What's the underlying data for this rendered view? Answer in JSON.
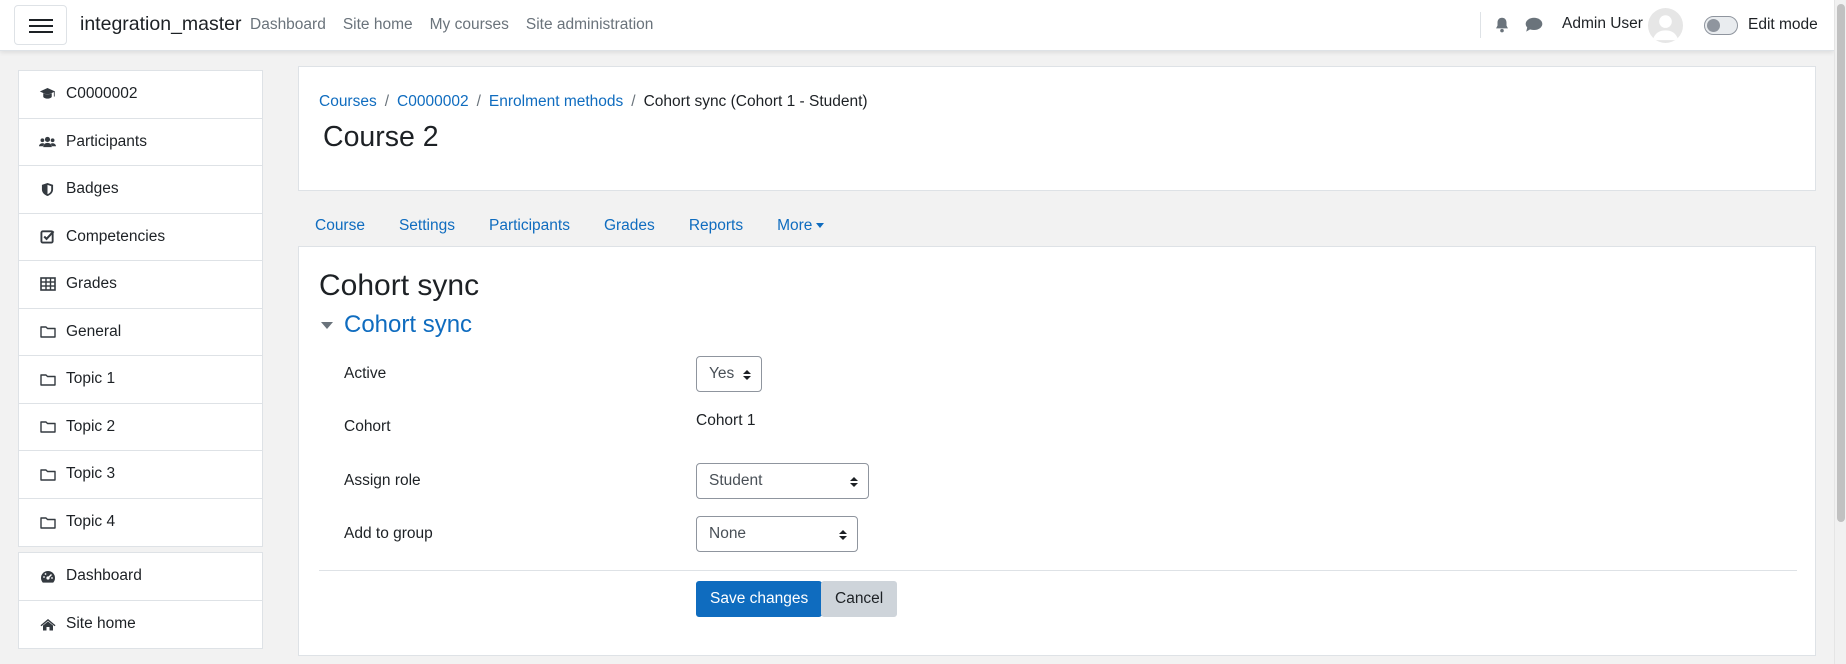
{
  "navbar": {
    "site_name": "integration_master",
    "links": [
      "Dashboard",
      "Site home",
      "My courses",
      "Site administration"
    ],
    "user_name": "Admin User",
    "edit_mode_label": "Edit mode",
    "edit_mode_on": false
  },
  "drawer": {
    "course_items": [
      {
        "label": "C0000002",
        "icon": "graduation-cap-icon"
      },
      {
        "label": "Participants",
        "icon": "users-icon"
      },
      {
        "label": "Badges",
        "icon": "shield-icon"
      },
      {
        "label": "Competencies",
        "icon": "checkbox-icon"
      },
      {
        "label": "Grades",
        "icon": "table-icon"
      },
      {
        "label": "General",
        "icon": "folder-icon"
      },
      {
        "label": "Topic 1",
        "icon": "folder-icon"
      },
      {
        "label": "Topic 2",
        "icon": "folder-icon"
      },
      {
        "label": "Topic 3",
        "icon": "folder-icon"
      },
      {
        "label": "Topic 4",
        "icon": "folder-icon"
      }
    ],
    "site_items": [
      {
        "label": "Dashboard",
        "icon": "dashboard-icon"
      },
      {
        "label": "Site home",
        "icon": "home-icon"
      }
    ]
  },
  "header": {
    "breadcrumb": [
      "Courses",
      "C0000002",
      "Enrolment methods"
    ],
    "breadcrumb_current": "Cohort sync (Cohort 1 - Student)",
    "title": "Course 2"
  },
  "secondary_nav": {
    "items": [
      "Course",
      "Settings",
      "Participants",
      "Grades",
      "Reports"
    ],
    "more_label": "More"
  },
  "form": {
    "heading": "Cohort sync",
    "section_title": "Cohort sync",
    "active_label": "Active",
    "active_value": "Yes",
    "cohort_label": "Cohort",
    "cohort_value": "Cohort 1",
    "role_label": "Assign role",
    "role_value": "Student",
    "group_label": "Add to group",
    "group_value": "None",
    "save_label": "Save changes",
    "cancel_label": "Cancel"
  },
  "colors": {
    "link": "#0f6cbf",
    "primary_button": "#0f6cbf",
    "secondary_button": "#ced4da",
    "page_background": "#f2f2f2"
  }
}
